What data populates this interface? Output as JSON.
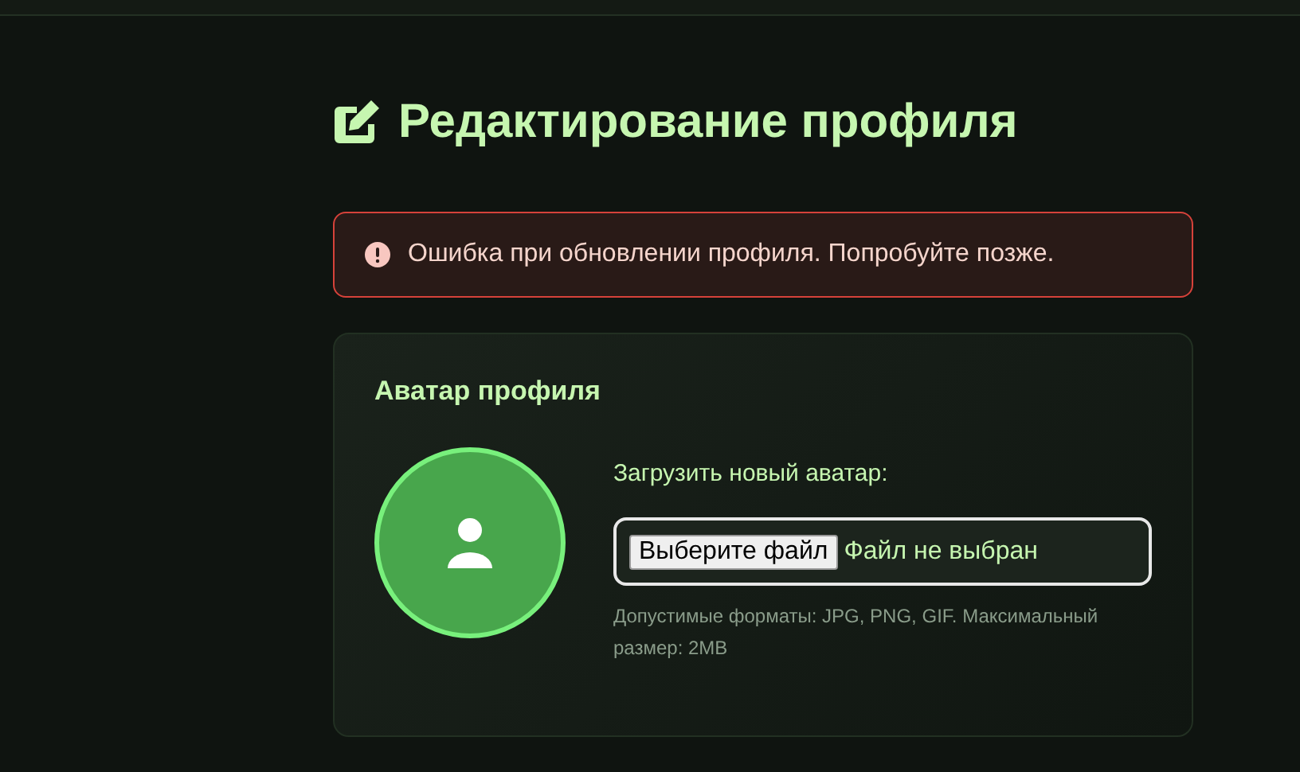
{
  "page": {
    "title": "Редактирование профиля"
  },
  "alert": {
    "kind": "error",
    "message": "Ошибка при обновлении профиля. Попробуйте позже."
  },
  "avatar_section": {
    "title": "Аватар профиля",
    "upload_label": "Загрузить новый аватар:",
    "file_button": "Выберите файл",
    "file_status": "Файл не выбран",
    "hint": "Допустимые форматы: JPG, PNG, GIF. Максимальный размер: 2MB"
  }
}
